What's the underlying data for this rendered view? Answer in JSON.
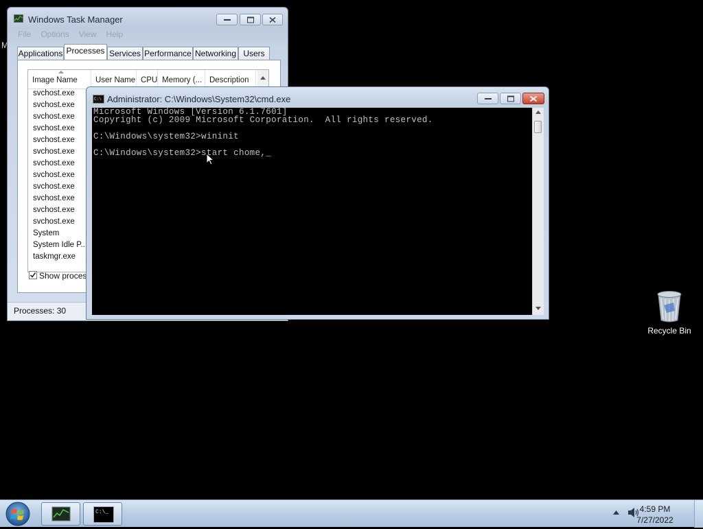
{
  "desktop": {
    "peek_letter": "M",
    "recycle_bin_label": "Recycle Bin"
  },
  "task_manager": {
    "title": "Windows Task Manager",
    "menu": [
      "File",
      "Options",
      "View",
      "Help"
    ],
    "tabs": [
      "Applications",
      "Processes",
      "Services",
      "Performance",
      "Networking",
      "Users"
    ],
    "active_tab": "Processes",
    "columns": [
      "Image Name",
      "User Name",
      "CPU",
      "Memory (...",
      "Description"
    ],
    "rows": [
      "svchost.exe",
      "svchost.exe",
      "svchost.exe",
      "svchost.exe",
      "svchost.exe",
      "svchost.exe",
      "svchost.exe",
      "svchost.exe",
      "svchost.exe",
      "svchost.exe",
      "svchost.exe",
      "svchost.exe",
      "System",
      "System Idle P...",
      "taskmgr.exe"
    ],
    "show_processes_label": "Show processes",
    "status": "Processes: 30"
  },
  "cmd": {
    "title": "Administrator: C:\\Windows\\System32\\cmd.exe",
    "lines": [
      "Microsoft Windows [Version 6.1.7601]",
      "Copyright (c) 2009 Microsoft Corporation.  All rights reserved.",
      "",
      "C:\\Windows\\system32>wininit",
      "",
      "C:\\Windows\\system32>start chome,_"
    ]
  },
  "taskbar": {
    "time": "4:59 PM",
    "date": "7/27/2022"
  }
}
